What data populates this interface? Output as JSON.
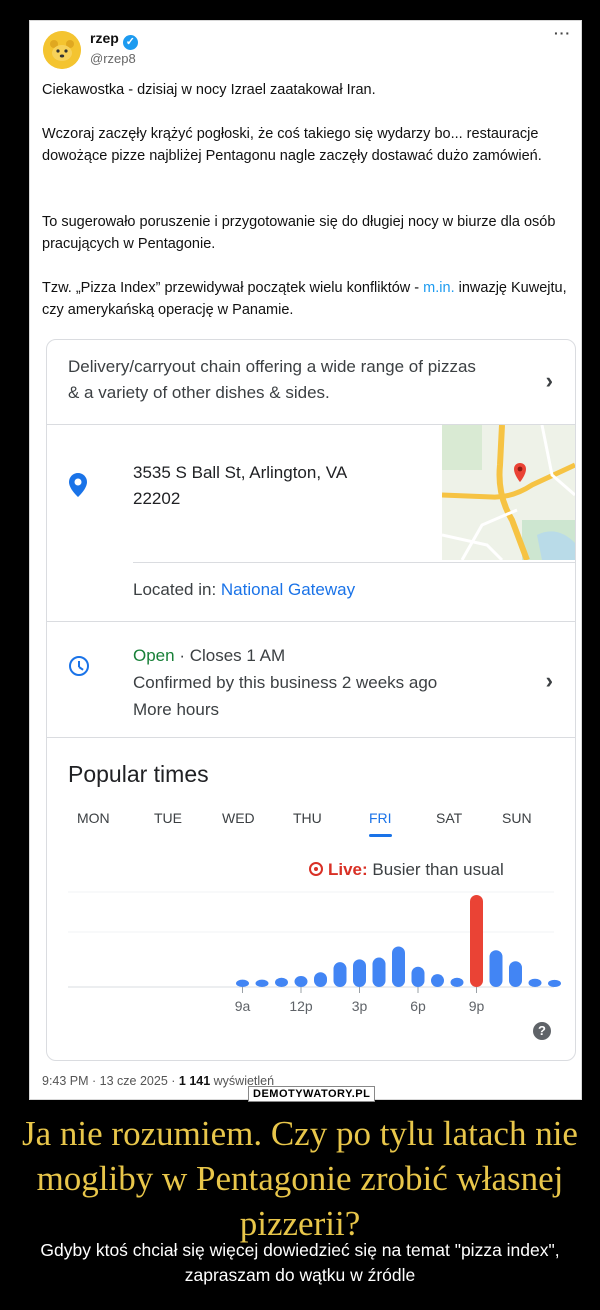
{
  "tweet": {
    "author_name": "rzep",
    "author_handle": "@rzep8",
    "more_label": "···",
    "paragraphs": [
      "Ciekawostka - dzisiaj w nocy Izrael zaatakował Iran.",
      "Wczoraj zaczęły krążyć pogłoski, że coś takiego się wydarzy bo... restauracje dowożące pizze najbliżej Pentagonu nagle zaczęły dostawać dużo zamówień.",
      "To sugerowało poruszenie i przygotowanie się do długiej nocy w biurze dla osób pracujących w Pentagonie."
    ],
    "p4_before": "Tzw. „Pizza Index” przewidywał początek wielu konfliktów - ",
    "p4_link": "m.in.",
    "p4_after": " inwazję Kuwejtu, czy amerykańską operację w Panamie.",
    "timestamp": "9:43 PM · 13 cze 2025 · ",
    "views": "1 141",
    "views_label": " wyświetleń"
  },
  "card": {
    "description": "Delivery/carryout chain offering a wide range of pizzas & a variety of other dishes & sides.",
    "address_line1": "3535 S Ball St, Arlington, VA",
    "address_line2": "22202",
    "located_prefix": "Located in: ",
    "located_link": "National Gateway",
    "open_status": "Open",
    "closes": " · Closes 1 AM",
    "confirmed": "Confirmed by this business 2 weeks ago",
    "more_hours": "More hours",
    "chevron": "›"
  },
  "popular_times": {
    "title": "Popular times",
    "days": [
      "MON",
      "TUE",
      "WED",
      "THU",
      "FRI",
      "SAT",
      "SUN"
    ],
    "selected_day": "FRI",
    "live_label": "Live:",
    "live_text": " Busier than usual",
    "help": "?"
  },
  "chart_data": {
    "type": "bar",
    "title": "",
    "x_ticks": [
      "9a",
      "12p",
      "3p",
      "6p",
      "9p"
    ],
    "hours": [
      "6a",
      "7a",
      "8a",
      "9a",
      "10a",
      "11a",
      "12p",
      "1p",
      "2p",
      "3p",
      "4p",
      "5p",
      "6p",
      "7p",
      "8p",
      "9p",
      "10p",
      "11p",
      "12a",
      "1a",
      "2a",
      "3a"
    ],
    "usual_values": [
      0,
      0,
      0,
      0.08,
      0.08,
      0.1,
      0.12,
      0.16,
      0.27,
      0.3,
      0.32,
      0.44,
      0.22,
      0.14,
      0.1,
      0,
      0.4,
      0.28,
      0.09,
      0.05,
      0,
      0
    ],
    "live_hour": "9p",
    "live_value": 1.0,
    "colors": {
      "usual": "#4285f4",
      "live": "#ea4335",
      "axis": "#dadce0"
    }
  },
  "watermark": "DEMOTYWATORY.PL",
  "caption": "Ja nie rozumiem. Czy po tylu latach nie mogliby w Pentagonie zrobić własnej pizzerii?",
  "subcaption": "Gdyby ktoś chciał się więcej dowiedzieć się na temat \"pizza index\", zapraszam do wątku w źródle"
}
